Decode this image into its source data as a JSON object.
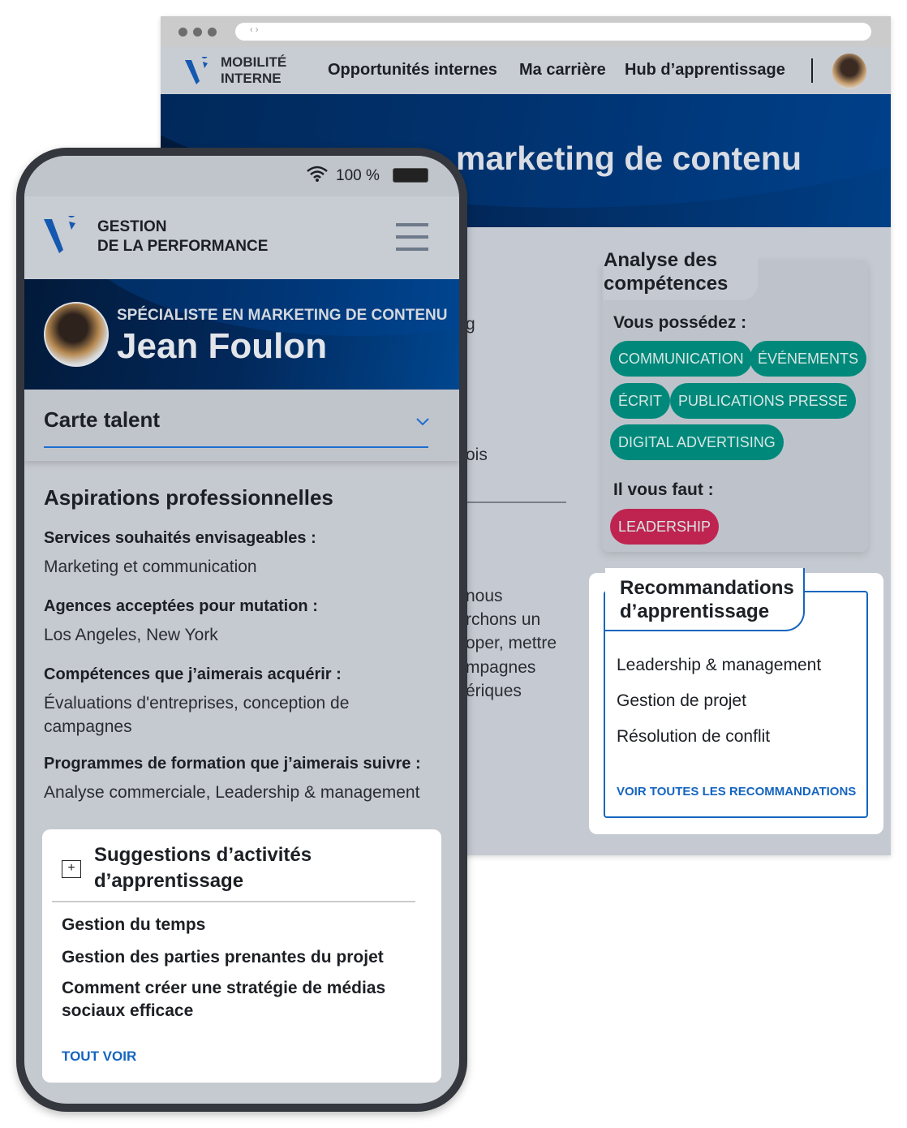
{
  "colors": {
    "brand": "#1558b0",
    "teal_chip": "#00897b",
    "red_chip": "#bf2450",
    "link": "#1565c0"
  },
  "browser": {
    "app_name_line1": "MOBILITÉ",
    "app_name_line2": "INTERNE",
    "nav": [
      "Opportunités internes",
      "Ma carrière",
      "Hub d’apprentissage"
    ],
    "url_icon": "‹ ›",
    "hero_title": "marketing de contenu",
    "occluded_fragments": [
      "g",
      "ois",
      "nous",
      "rchons un",
      "oper, mettre",
      "mpagnes",
      "ériques"
    ],
    "skills": {
      "title": "Analyse des compétences",
      "have_label": "Vous possédez :",
      "have": [
        "COMMUNICATION",
        "ÉVÉNEMENTS",
        "ÉCRIT",
        "PUBLICATIONS PRESSE",
        "DIGITAL ADVERTISING"
      ],
      "need_label": "Il vous faut :",
      "need": [
        "LEADERSHIP"
      ]
    },
    "reco": {
      "title": "Recommandations d’apprentissage",
      "items": [
        "Leadership & management",
        "Gestion de projet",
        "Résolution de conflit"
      ],
      "link": "VOIR TOUTES LES RECOMMANDATIONS"
    }
  },
  "phone": {
    "battery": "100 %",
    "app_name_line1": "GESTION",
    "app_name_line2": "DE LA PERFORMANCE",
    "job_title": "SPÉCIALISTE EN MARKETING DE CONTENU",
    "name": "Jean Foulon",
    "accordion": "Carte talent",
    "section_title": "Aspirations professionnelles",
    "fields": [
      {
        "label": "Services souhaités envisageables :",
        "value": "Marketing et communication"
      },
      {
        "label": "Agences acceptées pour mutation :",
        "value": "Los Angeles, New York"
      },
      {
        "label": "Compétences que j’aimerais acquérir :",
        "value": "Évaluations d'entreprises, conception de campagnes"
      },
      {
        "label": "Programmes de formation que j’aimerais suivre :",
        "value": "Analyse commerciale, Leadership & management"
      }
    ],
    "suggestions": {
      "title": "Suggestions d’activités d’apprentissage",
      "items": [
        "Gestion du temps",
        "Gestion des parties prenantes du projet",
        "Comment créer une stratégie de médias sociaux efficace"
      ],
      "link": "TOUT VOIR"
    }
  }
}
